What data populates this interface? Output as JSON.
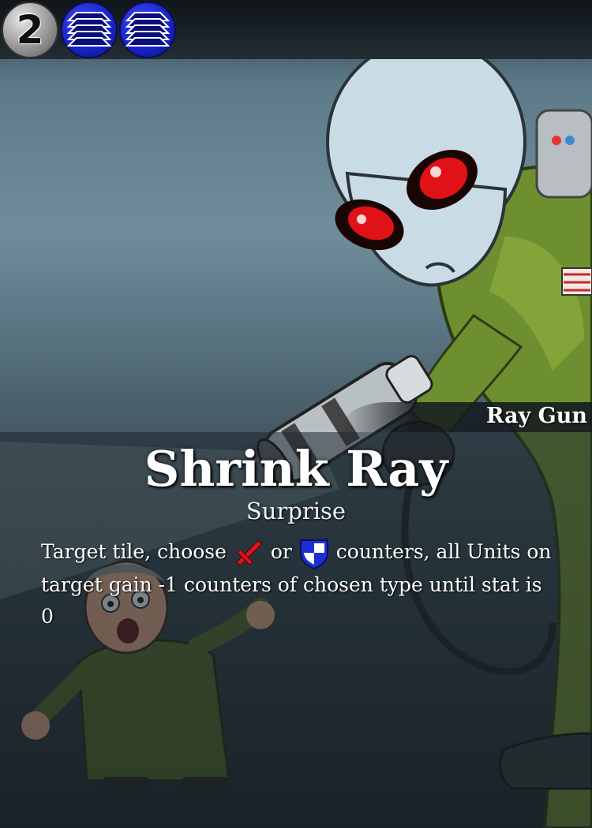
{
  "card": {
    "cost": "2",
    "resources": [
      {
        "icon": "blue-resource-icon",
        "color": "#2230e0"
      },
      {
        "icon": "blue-resource-icon",
        "color": "#2230e0"
      }
    ],
    "type_line": "Ray Gun",
    "name": "Shrink Ray",
    "subtype": "Surprise",
    "rules": {
      "part1": "Target tile, choose",
      "icon_attack": "red-sword-icon",
      "or_word": "or",
      "icon_defense": "blue-shield-icon",
      "part2": "counters, all Units on target gain -1 counters of chosen type until stat is 0"
    }
  },
  "colors": {
    "attack": "#e0141c",
    "defense": "#1a2fd6",
    "alien_skin": "#c9dbe4",
    "alien_eyes": "#e01218",
    "uniform": "#5f7f2a"
  }
}
